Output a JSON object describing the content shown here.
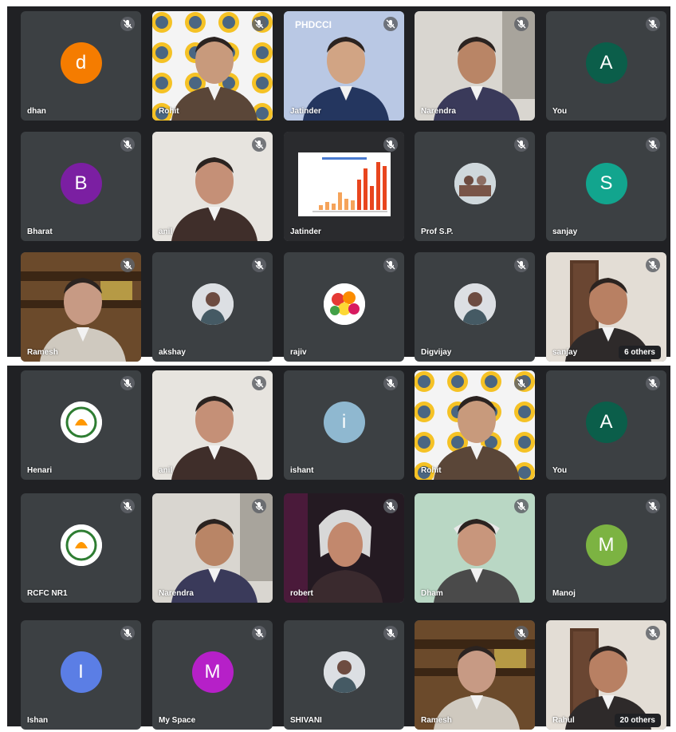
{
  "colors": {
    "call_background": "#202124",
    "tile_background": "#3c4043"
  },
  "top_grid": {
    "tiles": [
      {
        "name": "dhan",
        "initial": "d",
        "avatar_color": "#f57c00",
        "type": "avatar"
      },
      {
        "name": "Rohit",
        "type": "video",
        "scene": "backdrop-man"
      },
      {
        "name": "Jatinder",
        "type": "video",
        "scene": "backdrop-man-phdcci",
        "backdrop_text": "PHDCCI"
      },
      {
        "name": "Narendra",
        "type": "video",
        "scene": "man-office"
      },
      {
        "name": "You",
        "initial": "A",
        "avatar_color": "#0b5e4a",
        "type": "avatar"
      },
      {
        "name": "Bharat",
        "initial": "B",
        "avatar_color": "#7b1fa2",
        "type": "avatar"
      },
      {
        "name": "anil",
        "type": "video",
        "scene": "man-white-wall"
      },
      {
        "name": "Jatinder",
        "type": "video",
        "scene": "shared-chart"
      },
      {
        "name": "Prof S.P.",
        "type": "photo-avatar",
        "icon": "room-photo-icon"
      },
      {
        "name": "sanjay",
        "initial": "S",
        "avatar_color": "#12a58e",
        "type": "avatar"
      },
      {
        "name": "Ramesh",
        "type": "video",
        "scene": "man-shelves"
      },
      {
        "name": "akshay",
        "type": "photo-avatar",
        "icon": "person-photo-icon"
      },
      {
        "name": "rajiv",
        "type": "photo-avatar",
        "icon": "flowers-photo-icon"
      },
      {
        "name": "Digvijay",
        "type": "photo-avatar",
        "icon": "person-photo-icon"
      },
      {
        "name": "sanjay",
        "type": "video",
        "scene": "man-door",
        "overflow_label": "6 others"
      }
    ]
  },
  "bottom_grid": {
    "tiles": [
      {
        "name": "Henari",
        "type": "photo-avatar",
        "icon": "logo-photo-icon"
      },
      {
        "name": "anil",
        "type": "video",
        "scene": "man-white-wall"
      },
      {
        "name": "ishant",
        "initial": "i",
        "avatar_color": "#8fb8d0",
        "type": "avatar"
      },
      {
        "name": "Rohit",
        "type": "video",
        "scene": "backdrop-man"
      },
      {
        "name": "You",
        "initial": "A",
        "avatar_color": "#0b5e4a",
        "type": "avatar"
      },
      {
        "name": "RCFC NR1",
        "type": "photo-avatar",
        "icon": "logo-photo-icon"
      },
      {
        "name": "Narendra",
        "type": "video",
        "scene": "man-office"
      },
      {
        "name": "robert",
        "type": "video",
        "scene": "woman-dark"
      },
      {
        "name": "Dham",
        "type": "video",
        "scene": "elder-green"
      },
      {
        "name": "Manoj",
        "initial": "M",
        "avatar_color": "#7cb342",
        "type": "avatar"
      },
      {
        "name": "Ishan",
        "initial": "I",
        "avatar_color": "#5b7ee5",
        "type": "avatar"
      },
      {
        "name": "My Space",
        "initial": "M",
        "avatar_color": "#b620c8",
        "type": "avatar"
      },
      {
        "name": "SHIVANI",
        "type": "photo-avatar",
        "icon": "person-photo-icon"
      },
      {
        "name": "Ramesh",
        "type": "video",
        "scene": "man-shelves"
      },
      {
        "name": "Rahul",
        "type": "video",
        "scene": "man-door",
        "overflow_label": "20 others"
      }
    ]
  }
}
